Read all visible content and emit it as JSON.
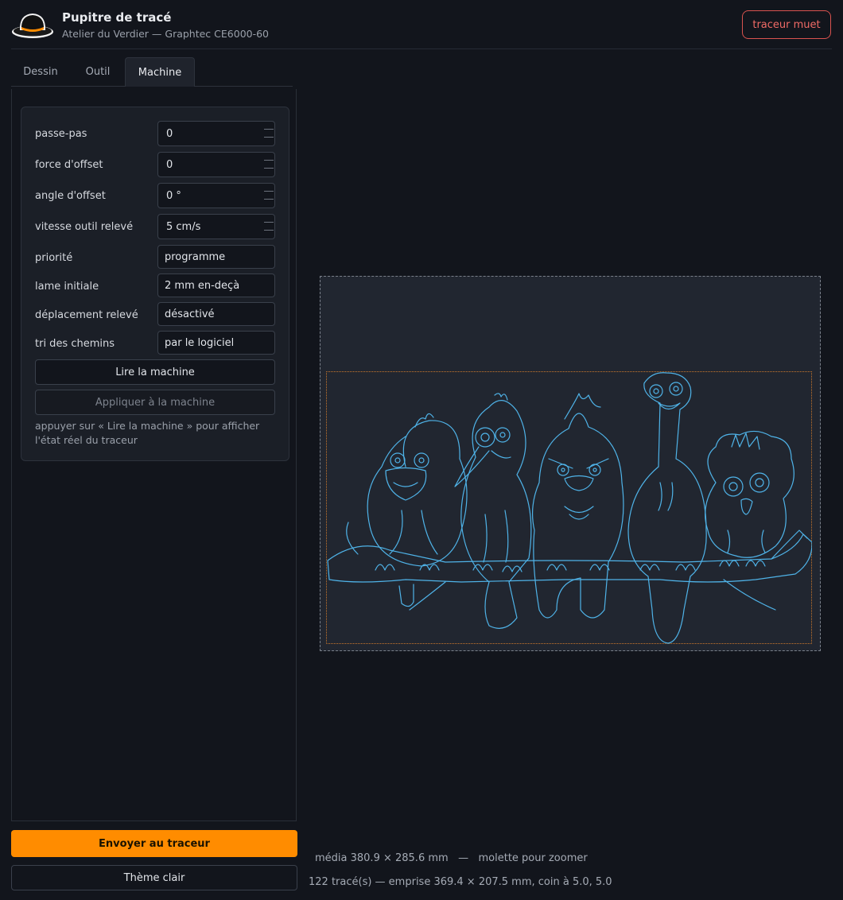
{
  "header": {
    "title": "Pupitre de tracé",
    "subtitle": "Atelier du Verdier — Graphtec CE6000-60",
    "mute_button": "traceur muet"
  },
  "tabs": [
    {
      "label": "Dessin",
      "active": false
    },
    {
      "label": "Outil",
      "active": false
    },
    {
      "label": "Machine",
      "active": true
    }
  ],
  "machine": {
    "fields": [
      {
        "label": "passe-pas",
        "value": "0"
      },
      {
        "label": "force d'offset",
        "value": "0"
      },
      {
        "label": "angle d'offset",
        "value": "0 °"
      },
      {
        "label": "vitesse outil relevé",
        "value": "5 cm/s"
      },
      {
        "label": "priorité",
        "value": "programme"
      },
      {
        "label": "lame initiale",
        "value": "2 mm en-deçà"
      },
      {
        "label": "déplacement relevé",
        "value": "désactivé"
      },
      {
        "label": "tri des chemins",
        "value": "par le logiciel"
      }
    ],
    "read_button": "Lire la machine",
    "apply_button": "Appliquer à la machine",
    "hint": "appuyer sur « Lire la machine » pour afficher l'état réel du traceur"
  },
  "actions": {
    "send": "Envoyer au traceur",
    "theme": "Thème clair"
  },
  "status": {
    "media": "média 380.9 × 285.6 mm",
    "separator": "—",
    "zoom_hint": "molette pour zoomer",
    "summary": "122 tracé(s) — emprise 369.4 × 207.5 mm, coin à 5.0, 5.0"
  },
  "colors": {
    "accent": "#ff8c00",
    "mute": "#f06b66",
    "trace": "#4fb3e8",
    "margin": "#c9772c"
  },
  "icons": {
    "logo": "bowler-hat-icon"
  }
}
